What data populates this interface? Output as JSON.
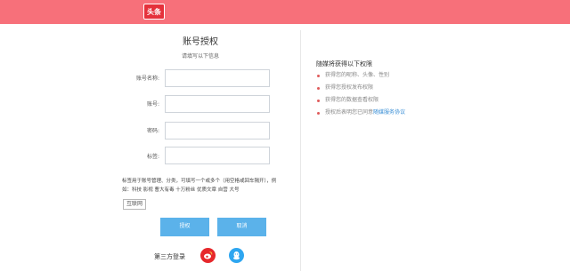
{
  "header": {
    "logo_text": "头条"
  },
  "form": {
    "title": "账号授权",
    "subtitle": "请填写以下信息",
    "fields": [
      {
        "label": "账号名称:",
        "value": ""
      },
      {
        "label": "账号:",
        "value": ""
      },
      {
        "label": "密码:",
        "value": ""
      },
      {
        "label": "标签:",
        "value": ""
      }
    ],
    "note": "标签用于账号管理、分类，可填写一个或多个（用空格或回车隔开），例如：科技 影视 曹大有毒 十万粉丝 优质文章 自营 大号",
    "tag_chip": "互联网",
    "authorize_button": "授权",
    "cancel_button": "取消",
    "third_party_label": "第三方登录"
  },
  "right_panel": {
    "title": "随媒将获得以下权限",
    "items": [
      "获得您的昵称、头像、性别",
      "获得您授权发布权限",
      "获得您的数据查看权限"
    ],
    "agreement_prefix": "授权后表明您已同意",
    "agreement_link": "随媒服务协议"
  },
  "colors": {
    "header": "#f7707a",
    "accent_button": "#5bb2ea",
    "weibo": "#e6282c",
    "qq": "#2ea6f0"
  },
  "icons": {
    "logo": "toutiao-logo",
    "weibo": "weibo-icon",
    "qq": "qq-icon"
  }
}
